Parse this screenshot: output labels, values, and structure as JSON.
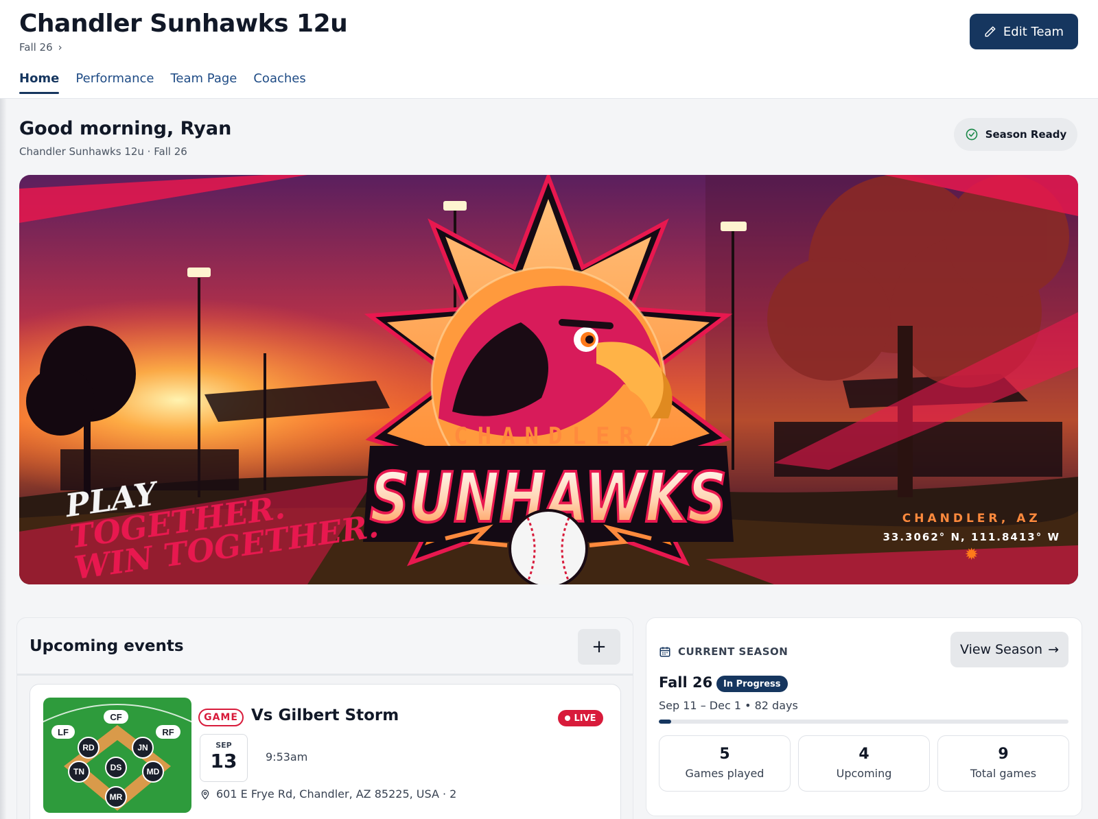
{
  "header": {
    "team_title": "Chandler Sunhawks 12u",
    "season": "Fall 26",
    "edit_label": "Edit Team",
    "tabs": [
      {
        "label": "Home",
        "active": true
      },
      {
        "label": "Performance",
        "active": false
      },
      {
        "label": "Team Page",
        "active": false
      },
      {
        "label": "Coaches",
        "active": false
      }
    ]
  },
  "greeting": {
    "title": "Good morning, Ryan",
    "subtitle": "Chandler Sunhawks 12u · Fall 26",
    "status": "Season Ready"
  },
  "banner": {
    "brand_top": "CHANDLER",
    "brand_main": "SUNHAWKS",
    "tagline": [
      "PLAY",
      "TOGETHER.",
      "WIN TOGETHER."
    ],
    "city": "CHANDLER, AZ",
    "coords": "33.3062° N, 111.8413° W"
  },
  "events": {
    "title": "Upcoming events",
    "add_label": "+",
    "items": [
      {
        "type": "GAME",
        "name": "Vs Gilbert Storm",
        "live": "LIVE",
        "month": "SEP",
        "day": "13",
        "time": "9:53am",
        "address": "601 E Frye Rd, Chandler, AZ 85225, USA · 2",
        "positions": {
          "CF": "CF",
          "LF": "LF",
          "RF": "RF",
          "RD": "RD",
          "JN": "JN",
          "TN": "TN",
          "DS": "DS",
          "MD": "MD",
          "MR": "MR"
        }
      }
    ]
  },
  "season": {
    "label": "CURRENT SEASON",
    "view_label": "View Season",
    "name": "Fall 26",
    "status": "In Progress",
    "dates": "Sep 11 – Dec 1 • 82 days",
    "progress": 0.03,
    "stats": [
      {
        "value": "5",
        "label": "Games played"
      },
      {
        "value": "4",
        "label": "Upcoming"
      },
      {
        "value": "9",
        "label": "Total games"
      }
    ]
  },
  "colors": {
    "primary": "#16365f",
    "live_red": "#d81b3b",
    "banner_pink": "#e8184f",
    "banner_orange": "#ff8a3d"
  }
}
